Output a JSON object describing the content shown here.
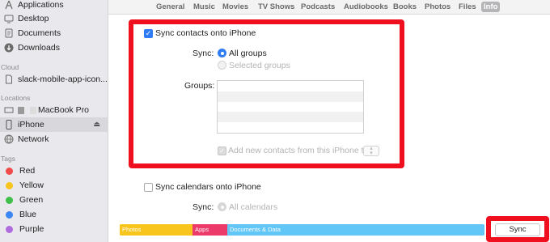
{
  "sidebar": {
    "favorites": [
      {
        "label": "Applications",
        "icon": "applications-icon"
      },
      {
        "label": "Desktop",
        "icon": "desktop-folder-icon"
      },
      {
        "label": "Documents",
        "icon": "documents-icon"
      },
      {
        "label": "Downloads",
        "icon": "downloads-icon"
      }
    ],
    "icloud_header": "Cloud",
    "icloud": [
      {
        "label": "slack-mobile-app-icon...",
        "icon": "file-icon"
      }
    ],
    "locations_header": "Locations",
    "locations": [
      {
        "label": "MacBook Pro",
        "icon": "laptop-icon"
      },
      {
        "label": "iPhone",
        "icon": "phone-icon",
        "selected": true
      },
      {
        "label": "Network",
        "icon": "network-globe-icon"
      }
    ],
    "tags_header": "Tags",
    "tags": [
      {
        "label": "Red",
        "color": "#f04a4a"
      },
      {
        "label": "Yellow",
        "color": "#f7c51d"
      },
      {
        "label": "Green",
        "color": "#3fc04a"
      },
      {
        "label": "Blue",
        "color": "#3a86f4"
      },
      {
        "label": "Purple",
        "color": "#b06be0"
      }
    ]
  },
  "tabs": [
    {
      "label": "General"
    },
    {
      "label": "Music"
    },
    {
      "label": "Movies"
    },
    {
      "label": "TV Shows"
    },
    {
      "label": "Podcasts"
    },
    {
      "label": "Audiobooks"
    },
    {
      "label": "Books"
    },
    {
      "label": "Photos"
    },
    {
      "label": "Files"
    },
    {
      "label": "Info",
      "active": true
    }
  ],
  "contacts": {
    "sync_label": "Sync contacts onto iPhone",
    "sync_checked": true,
    "sync_prefix": "Sync:",
    "option_all": "All groups",
    "option_selected": "Selected groups",
    "groups_label": "Groups:",
    "add_new_label": "Add new contacts from this iPhone to:"
  },
  "calendars": {
    "sync_label": "Sync calendars onto iPhone",
    "sync_checked": false,
    "sync_prefix": "Sync:",
    "option_all": "All calendars"
  },
  "storage": {
    "segments": [
      {
        "label": "Photos",
        "color": "#f8c51c"
      },
      {
        "label": "Apps",
        "color": "#ec3a6b"
      },
      {
        "label": "Documents & Data",
        "color": "#62c6f7"
      }
    ]
  },
  "sync_button": "Sync",
  "highlight_color": "#f00f1e"
}
